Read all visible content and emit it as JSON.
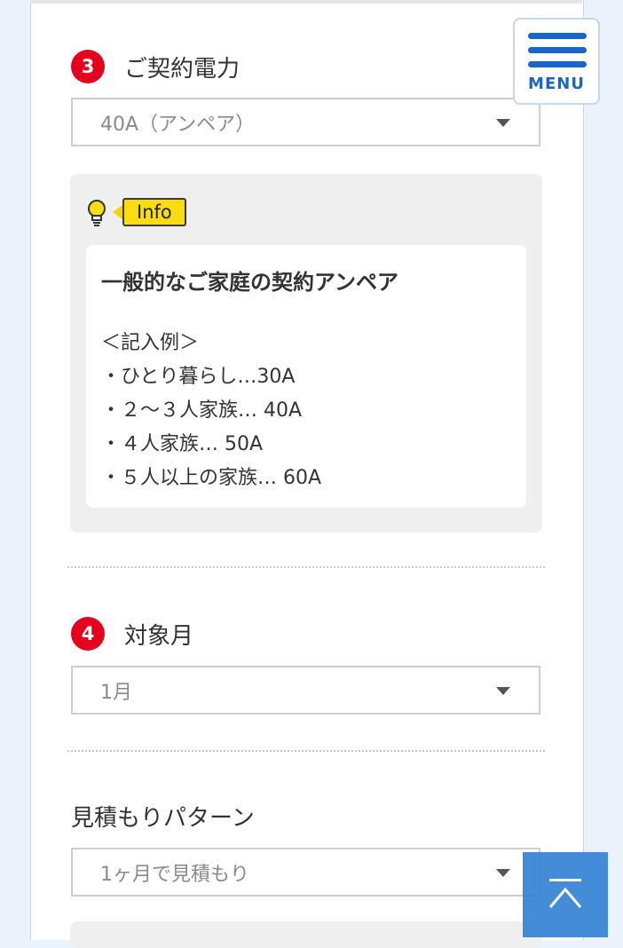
{
  "menu": {
    "label": "MENU"
  },
  "section3": {
    "number": "3",
    "title": "ご契約電力",
    "select_value": "40A（アンペア）"
  },
  "info": {
    "tag": "Info",
    "title": "一般的なご家庭の契約アンペア",
    "lines": [
      "＜記入例＞",
      "・ひとり暮らし…30A",
      "・２～３人家族… 40A",
      "・４人家族… 50A",
      "・５人以上の家族… 60A"
    ]
  },
  "section4": {
    "number": "4",
    "title": "対象月",
    "select_value": "1月"
  },
  "pattern": {
    "title": "見積もりパターン",
    "select_value": "1ヶ月で見積もり"
  },
  "icons": {
    "menu": "hamburger-icon",
    "info": "lightbulb-icon",
    "dropdown": "caret-down-icon",
    "back_to_top": "arrow-up-icon"
  },
  "colors": {
    "badge": "#e6001e",
    "menu_accent": "#1866c8",
    "info_tag": "#fbdc0e",
    "back_to_top": "#3b86d4"
  }
}
